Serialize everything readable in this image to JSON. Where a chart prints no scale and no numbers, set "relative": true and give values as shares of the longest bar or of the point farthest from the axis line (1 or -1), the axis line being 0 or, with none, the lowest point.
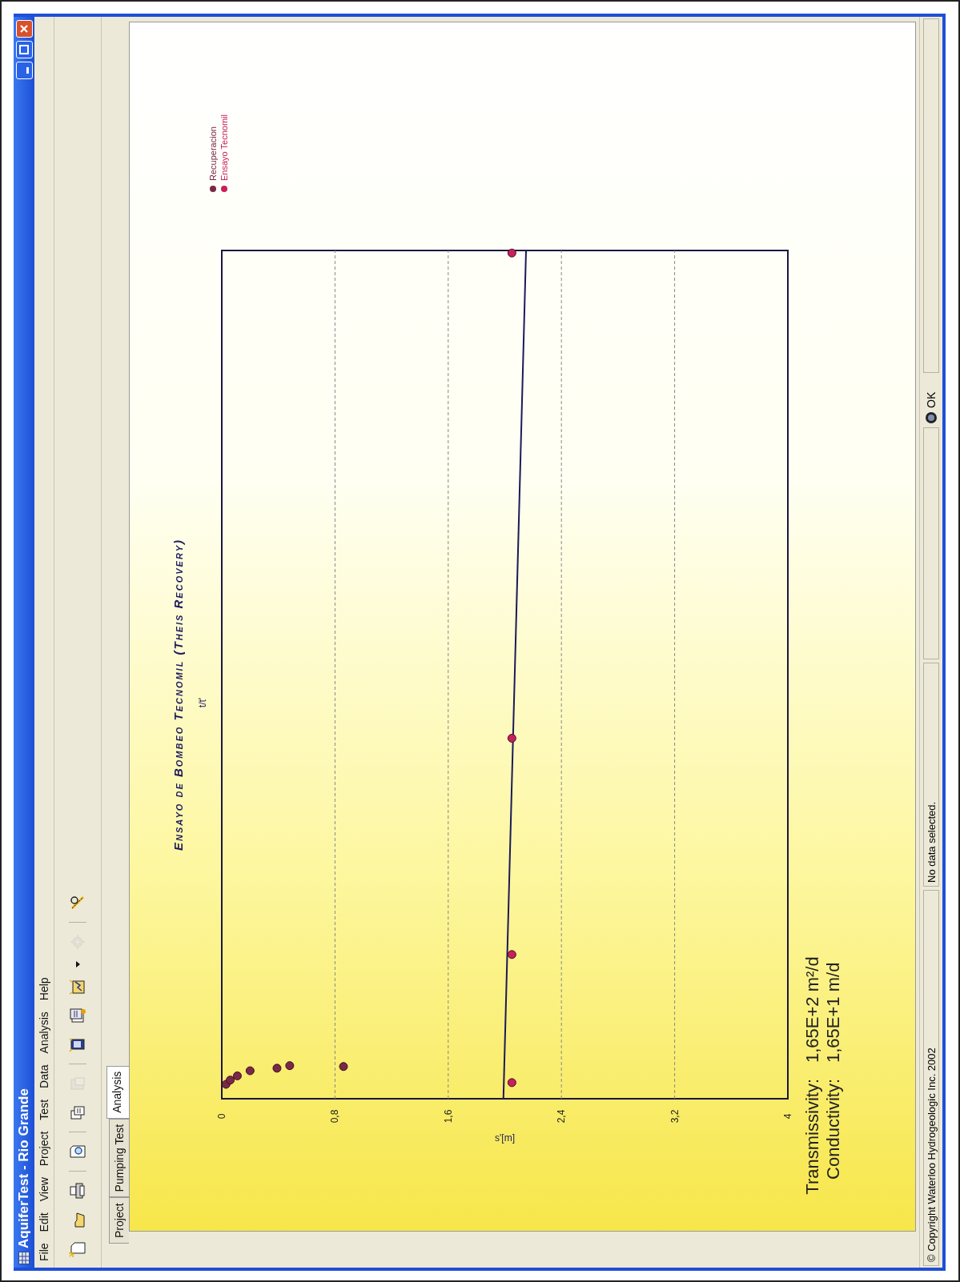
{
  "window": {
    "title": "AquiferTest - Rio Grande"
  },
  "menu": [
    "File",
    "Edit",
    "View",
    "Project",
    "Test",
    "Data",
    "Analysis",
    "Help"
  ],
  "toolbar": [
    {
      "kind": "new",
      "disabled": false
    },
    {
      "kind": "open",
      "disabled": false
    },
    {
      "kind": "print",
      "disabled": false
    },
    {
      "kind": "separator"
    },
    {
      "kind": "preview",
      "disabled": false
    },
    {
      "kind": "separator"
    },
    {
      "kind": "copy",
      "disabled": false
    },
    {
      "kind": "paste",
      "disabled": true
    },
    {
      "kind": "separator"
    },
    {
      "kind": "report",
      "disabled": false
    },
    {
      "kind": "wizard",
      "disabled": false
    },
    {
      "kind": "chart",
      "disabled": false
    },
    {
      "kind": "dropdown"
    },
    {
      "kind": "gear",
      "disabled": true
    },
    {
      "kind": "separator"
    },
    {
      "kind": "tool",
      "disabled": false
    }
  ],
  "tabs": [
    {
      "label": "Project",
      "selected": false
    },
    {
      "label": "Pumping Test",
      "selected": false
    },
    {
      "label": "Analysis",
      "selected": true
    }
  ],
  "chart": {
    "chart_data": {
      "type": "scatter",
      "title": "Ensayo de Bombeo Tecnomil (Theis Recovery)",
      "xlabel": "s'[m]",
      "ylabel": "t/t'",
      "xlim": [
        0,
        4
      ],
      "relative": true,
      "grid": true,
      "xticks": [
        {
          "value": 0,
          "label": "0"
        },
        {
          "value": 0.8,
          "label": "0,8"
        },
        {
          "value": 1.6,
          "label": "1,6"
        },
        {
          "value": 2.4,
          "label": "2,4"
        },
        {
          "value": 3.2,
          "label": "3,2"
        },
        {
          "value": 4,
          "label": "4"
        }
      ],
      "series": [
        {
          "name": "Recuperacion",
          "color": "#7a2848",
          "x": [
            0.03,
            0.06,
            0.11,
            0.2,
            0.39,
            0.48,
            0.86
          ],
          "values": [
            0.017,
            0.022,
            0.027,
            0.033,
            0.036,
            0.039,
            0.038
          ]
        },
        {
          "name": "Ensayo Tecnomil",
          "color": "#c8205a",
          "x": [
            2.05,
            2.05,
            2.05,
            2.05
          ],
          "values": [
            0.019,
            0.17,
            0.425,
            0.997
          ]
        },
        {
          "type": "line",
          "color": "#1c1a5a",
          "x": [
            1.99,
            2.15
          ],
          "values": [
            0,
            1
          ]
        }
      ]
    }
  },
  "results": [
    {
      "label": "Transmissivity:",
      "value": "1,65E+2 m²/d"
    },
    {
      "label": "Conductivity:",
      "value": "1,65E+1 m/d"
    }
  ],
  "status_bar": {
    "copyright": "© Copyright Waterloo Hydrogeologic Inc. 2002",
    "message": "No data selected.",
    "state": "OK"
  }
}
